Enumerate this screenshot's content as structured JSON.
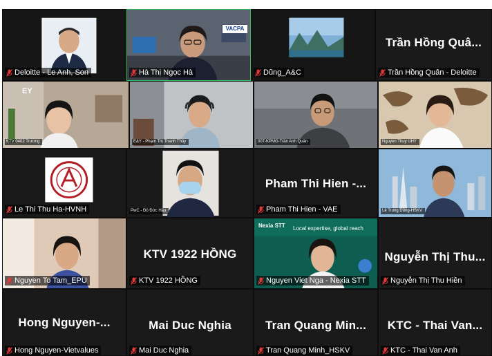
{
  "colors": {
    "tile_bg": "#1a1a1a",
    "active_border": "#2ec45a",
    "muted_icon": "#e03a3a",
    "label_text": "#ffffff"
  },
  "tiles": [
    {
      "label": "Deloitte - Le Anh, Son",
      "big": "",
      "muted": true
    },
    {
      "label": "Hà Thị Ngọc Hà",
      "big": "",
      "muted": true,
      "badge": "VACPA"
    },
    {
      "label": "Dũng_A&C",
      "big": "",
      "muted": true
    },
    {
      "label": "Trần Hồng Quân - Deloitte",
      "big": "Trần Hồng Quâ...",
      "muted": true
    },
    {
      "label": "KTV 0402 Trương",
      "big": "",
      "muted": false,
      "badge": "EY"
    },
    {
      "label": "E&Y - Phạm Thị Thanh Thủy",
      "big": "",
      "muted": false
    },
    {
      "label": "007-KPMG-Trần Anh Quân",
      "big": "",
      "muted": false
    },
    {
      "label": "Nguyen Thuy UHY",
      "big": "",
      "muted": false
    },
    {
      "label": "Le Thi Thu Ha-HVNH",
      "big": "",
      "muted": true
    },
    {
      "label": "PwC - Đỗ Đức Hậu",
      "big": "",
      "muted": false
    },
    {
      "label": "Pham Thi Hien - VAE",
      "big": "Pham Thi Hien -...",
      "muted": true
    },
    {
      "label": "Lê Trung Dũng-HSKV",
      "big": "",
      "muted": false
    },
    {
      "label": "Nguyen To Tam_EPU",
      "big": "",
      "muted": true
    },
    {
      "label": "KTV 1922 HỒNG",
      "big": "KTV 1922 HỒNG",
      "muted": true
    },
    {
      "label": "Nguyen Viet Nga - Nexia STT",
      "big": "",
      "muted": true,
      "banner": "Local expertise, global reach",
      "brand": "Nexia STT"
    },
    {
      "label": "Nguyễn Thị Thu Hiền",
      "big": "Nguyễn Thị Thu...",
      "muted": true
    },
    {
      "label": "Hong Nguyen-Vietvalues",
      "big": "Hong Nguyen-...",
      "muted": true
    },
    {
      "label": "Mai Duc Nghia",
      "big": "Mai Duc Nghia",
      "muted": true
    },
    {
      "label": "Tran Quang Minh_HSKV",
      "big": "Tran Quang Min...",
      "muted": true
    },
    {
      "label": "KTC - Thai Van Anh",
      "big": "KTC - Thai Van...",
      "muted": true
    }
  ]
}
